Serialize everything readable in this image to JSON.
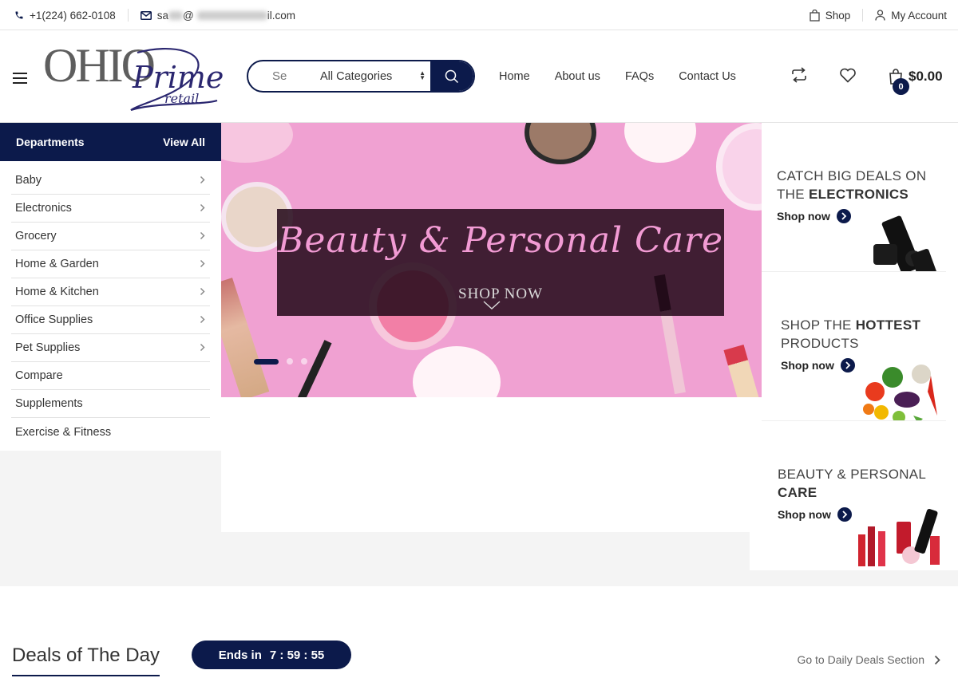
{
  "topbar": {
    "phone": "+1(224) 662-0108",
    "email_start": "sa",
    "email_at": "@",
    "email_end": "il.com",
    "shop_label": "Shop",
    "account_label": "My Account"
  },
  "header": {
    "logo": {
      "main": "OHIO",
      "accent": "Prime",
      "sub": "retail"
    },
    "search": {
      "placeholder": "Se",
      "category": "All Categories"
    },
    "nav": [
      "Home",
      "About us",
      "FAQs",
      "Contact Us"
    ],
    "cart": {
      "count": "0",
      "total": "$0.00"
    }
  },
  "departments": {
    "title": "Departments",
    "view_all": "View All",
    "items": [
      {
        "label": "Baby",
        "has_children": true
      },
      {
        "label": "Electronics",
        "has_children": true
      },
      {
        "label": "Grocery",
        "has_children": true
      },
      {
        "label": "Home & Garden",
        "has_children": true
      },
      {
        "label": "Home & Kitchen",
        "has_children": true
      },
      {
        "label": "Office Supplies",
        "has_children": true
      },
      {
        "label": "Pet Supplies",
        "has_children": true
      },
      {
        "label": "Compare",
        "has_children": false
      },
      {
        "label": "Supplements",
        "has_children": false
      },
      {
        "label": "Exercise & Fitness",
        "has_children": false
      }
    ]
  },
  "hero": {
    "title": "Beauty & Personal Care",
    "cta": "SHOP NOW",
    "slides": 3,
    "active_slide": 1
  },
  "promos": [
    {
      "line1": "CATCH BIG DEALS ON",
      "line2_prefix": "THE ",
      "line2_bold": "ELECTRONICS",
      "cta": "Shop now",
      "image": "electronics-phone-mount"
    },
    {
      "line1_prefix": "SHOP THE ",
      "line1_bold": "HOTTEST",
      "line2": "PRODUCTS",
      "cta": "Shop now",
      "image": "fresh-vegetables"
    },
    {
      "line1": "BEAUTY & PERSONAL",
      "line2_bold": "CARE",
      "cta": "Shop now",
      "image": "lipsticks-nail-polish"
    }
  ],
  "deals": {
    "title": "Deals of The Day",
    "ends_label": "Ends in",
    "countdown": "7 : 59 : 55",
    "link": "Go to Daily Deals Section"
  },
  "colors": {
    "brand_navy": "#0c1a4b",
    "hero_pink": "#f0a1d2",
    "logo_purple": "#2b2770",
    "light_grey": "#f4f4f4"
  }
}
